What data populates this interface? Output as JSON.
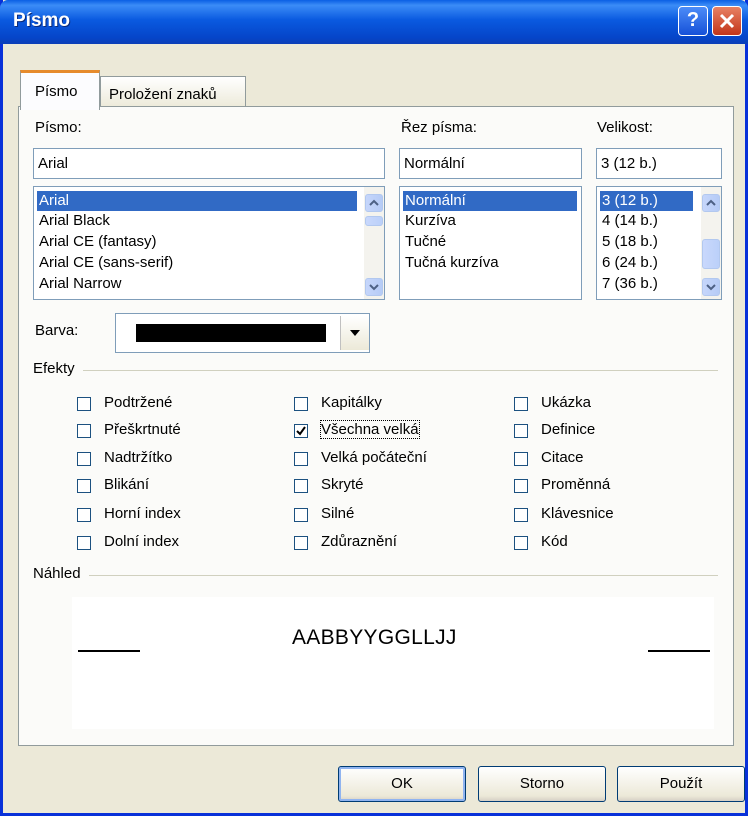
{
  "window": {
    "title": "Písmo",
    "help_label": "?"
  },
  "tabs": [
    {
      "label": "Písmo",
      "active": true
    },
    {
      "label": "Proložení znaků",
      "active": false
    }
  ],
  "font": {
    "label": "Písmo:",
    "value": "Arial",
    "items": [
      "Arial",
      "Arial Black",
      "Arial CE (fantasy)",
      "Arial CE (sans-serif)",
      "Arial Narrow"
    ],
    "selected": "Arial"
  },
  "style": {
    "label": "Řez písma:",
    "value": "Normální",
    "items": [
      "Normální",
      "Kurzíva",
      "Tučné",
      "Tučná kurzíva"
    ],
    "selected": "Normální"
  },
  "size": {
    "label": "Velikost:",
    "value": "3 (12 b.)",
    "items": [
      "3 (12 b.)",
      "4 (14 b.)",
      "5 (18 b.)",
      "6 (24 b.)",
      "7 (36 b.)"
    ],
    "selected": "3 (12 b.)"
  },
  "color": {
    "label": "Barva:",
    "value_color": "#000000"
  },
  "effects": {
    "label": "Efekty",
    "col1": [
      {
        "label": "Podtržené",
        "checked": false
      },
      {
        "label": "Přeškrtnuté",
        "checked": false
      },
      {
        "label": "Nadtržítko",
        "checked": false
      },
      {
        "label": "Blikání",
        "checked": false
      },
      {
        "label": "Horní index",
        "checked": false
      },
      {
        "label": "Dolní index",
        "checked": false
      }
    ],
    "col2": [
      {
        "label": "Kapitálky",
        "checked": false
      },
      {
        "label": "Všechna velká",
        "checked": true
      },
      {
        "label": "Velká počáteční",
        "checked": false
      },
      {
        "label": "Skryté",
        "checked": false
      },
      {
        "label": "Silné",
        "checked": false
      },
      {
        "label": "Zdůraznění",
        "checked": false
      }
    ],
    "col3": [
      {
        "label": "Ukázka",
        "checked": false
      },
      {
        "label": "Definice",
        "checked": false
      },
      {
        "label": "Citace",
        "checked": false
      },
      {
        "label": "Proměnná",
        "checked": false
      },
      {
        "label": "Klávesnice",
        "checked": false
      },
      {
        "label": "Kód",
        "checked": false
      }
    ]
  },
  "preview": {
    "label": "Náhled",
    "sample": "AABBYYGGLLJJ"
  },
  "buttons": {
    "ok": "OK",
    "cancel": "Storno",
    "apply": "Použít"
  },
  "colors": {
    "title_bar": "#0a5ae0",
    "selection": "#316ac5",
    "face": "#ece9d8"
  }
}
